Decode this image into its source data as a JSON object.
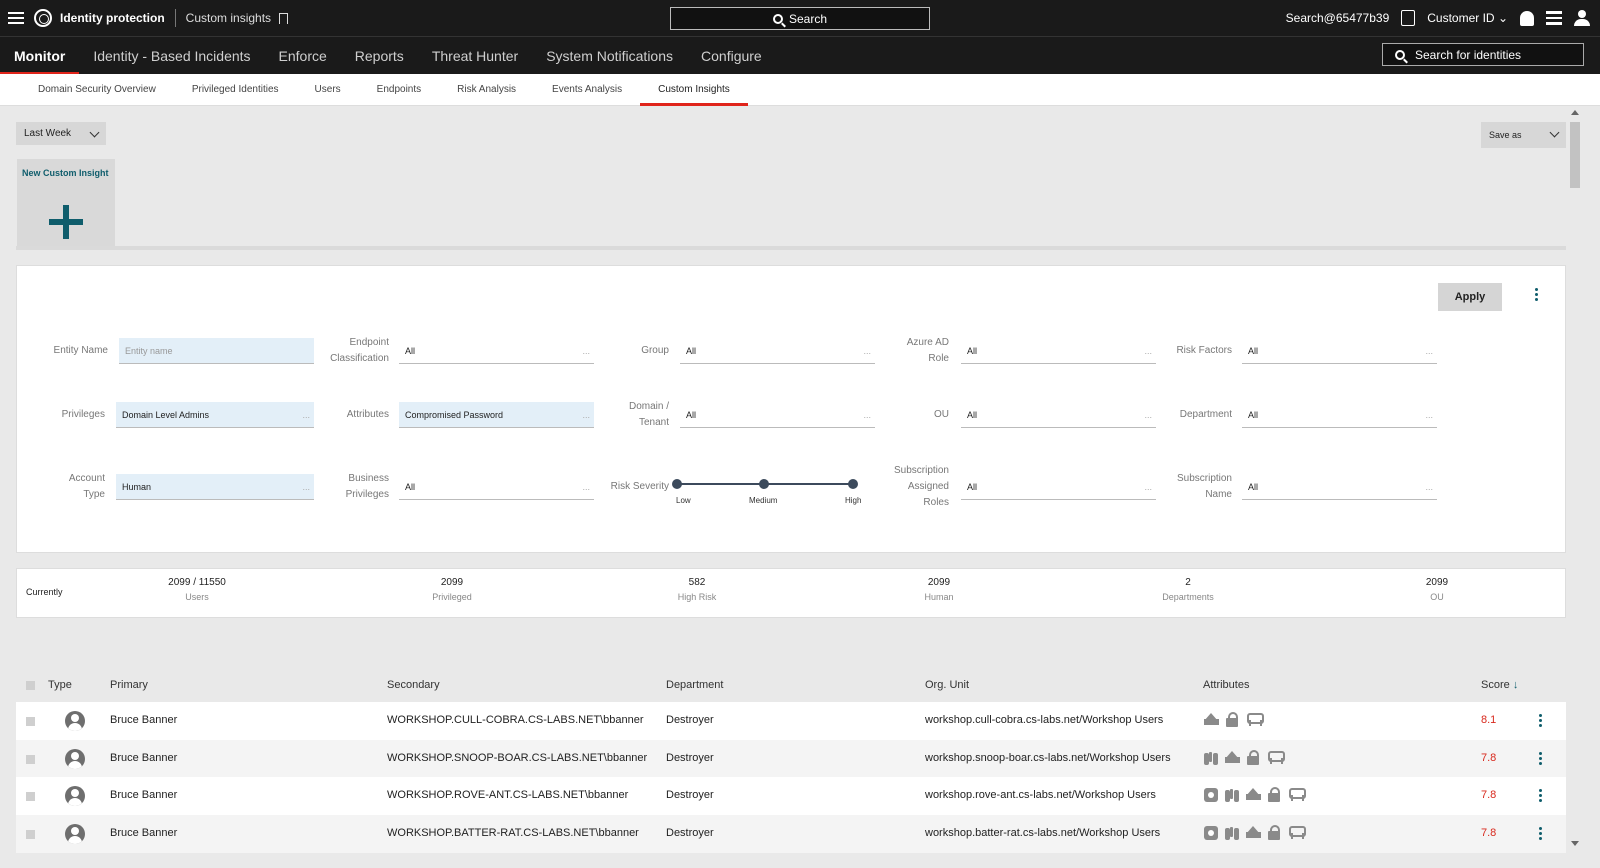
{
  "topbar": {
    "app_name": "Identity protection",
    "breadcrumb": "Custom insights",
    "search_label": "Search",
    "account": "Search@65477b39",
    "customer": "Customer ID"
  },
  "nav": {
    "items": [
      "Monitor",
      "Identity - Based Incidents",
      "Enforce",
      "Reports",
      "Threat Hunter",
      "System Notifications",
      "Configure"
    ],
    "identity_search_placeholder": "Search for identities"
  },
  "subnav": {
    "tabs": [
      "Domain Security Overview",
      "Privileged Identities",
      "Users",
      "Endpoints",
      "Risk Analysis",
      "Events Analysis",
      "Custom Insights"
    ]
  },
  "toolbar": {
    "period": "Last Week",
    "save_as": "Save as"
  },
  "new_insight": {
    "label": "New Custom Insight"
  },
  "filters": {
    "apply": "Apply",
    "entity_name": {
      "label": "Entity Name",
      "placeholder": "Entity name"
    },
    "endpoint_classification": {
      "label_1": "Endpoint",
      "label_2": "Classification",
      "value": "All"
    },
    "group": {
      "label": "Group",
      "value": "All"
    },
    "azure_ad_role": {
      "label_1": "Azure AD",
      "label_2": "Role",
      "value": "All"
    },
    "risk_factors": {
      "label": "Risk Factors",
      "value": "All"
    },
    "privileges": {
      "label": "Privileges",
      "value": "Domain Level Admins"
    },
    "attributes": {
      "label": "Attributes",
      "value": "Compromised Password"
    },
    "domain_tenant": {
      "label_1": "Domain /",
      "label_2": "Tenant",
      "value": "All"
    },
    "ou": {
      "label": "OU",
      "value": "All"
    },
    "department": {
      "label": "Department",
      "value": "All"
    },
    "account_type": {
      "label_1": "Account",
      "label_2": "Type",
      "value": "Human"
    },
    "business_privileges": {
      "label_1": "Business",
      "label_2": "Privileges",
      "value": "All"
    },
    "risk_severity": {
      "label": "Risk Severity",
      "levels": [
        "Low",
        "Medium",
        "High"
      ]
    },
    "subscription_roles": {
      "label_1": "Subscription",
      "label_2": "Assigned",
      "label_3": "Roles",
      "value": "All"
    },
    "subscription_name": {
      "label_1": "Subscription",
      "label_2": "Name",
      "value": "All"
    },
    "more_symbol": "..."
  },
  "summary": {
    "currently": "Currently",
    "stats": [
      {
        "value": "2099 / 11550",
        "label": "Users"
      },
      {
        "value": "2099",
        "label": "Privileged"
      },
      {
        "value": "582",
        "label": "High Risk"
      },
      {
        "value": "2099",
        "label": "Human"
      },
      {
        "value": "2",
        "label": "Departments"
      },
      {
        "value": "2099",
        "label": "OU"
      }
    ]
  },
  "table": {
    "headers": {
      "type": "Type",
      "primary": "Primary",
      "secondary": "Secondary",
      "department": "Department",
      "org_unit": "Org. Unit",
      "attributes": "Attributes",
      "score": "Score"
    },
    "rows": [
      {
        "primary": "Bruce Banner",
        "secondary": "WORKSHOP.CULL-COBRA.CS-LABS.NET\\bbanner",
        "department": "Destroyer",
        "org_unit": "workshop.cull-cobra.cs-labs.net/Workshop Users",
        "attributes": [
          "crown-icon",
          "lock-icon",
          "hand-icon"
        ],
        "score": "8.1"
      },
      {
        "primary": "Bruce Banner",
        "secondary": "WORKSHOP.SNOOP-BOAR.CS-LABS.NET\\bbanner",
        "department": "Destroyer",
        "org_unit": "workshop.snoop-boar.cs-labs.net/Workshop Users",
        "attributes": [
          "binoculars-icon",
          "crown-icon",
          "lock-icon",
          "hand-icon"
        ],
        "score": "7.8"
      },
      {
        "primary": "Bruce Banner",
        "secondary": "WORKSHOP.ROVE-ANT.CS-LABS.NET\\bbanner",
        "department": "Destroyer",
        "org_unit": "workshop.rove-ant.cs-labs.net/Workshop Users",
        "attributes": [
          "gear-icon",
          "binoculars-icon",
          "crown-icon",
          "lock-icon",
          "hand-icon"
        ],
        "score": "7.8"
      },
      {
        "primary": "Bruce Banner",
        "secondary": "WORKSHOP.BATTER-RAT.CS-LABS.NET\\bbanner",
        "department": "Destroyer",
        "org_unit": "workshop.batter-rat.cs-labs.net/Workshop Users",
        "attributes": [
          "gear-icon",
          "binoculars-icon",
          "crown-icon",
          "lock-icon",
          "hand-icon"
        ],
        "score": "7.8"
      }
    ]
  },
  "colors": {
    "accent": "#e0241b",
    "teal": "#0f5d6c",
    "score": "#d8281c"
  }
}
